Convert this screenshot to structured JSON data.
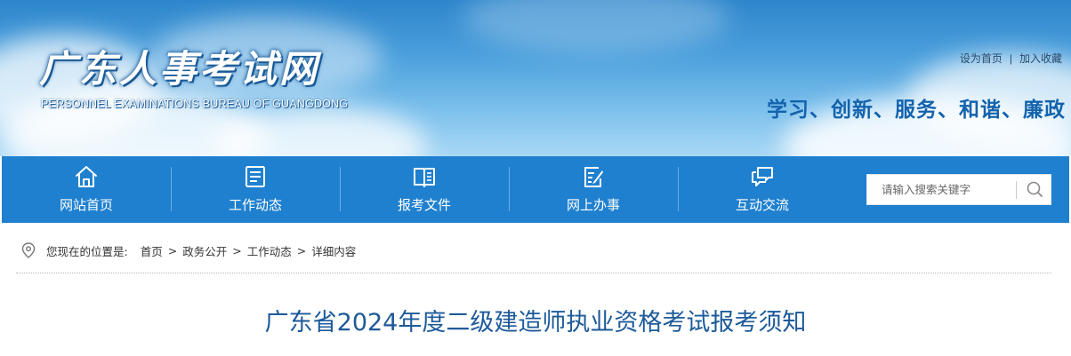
{
  "header": {
    "site_title": "广东人事考试网",
    "site_subtitle": "PERSONNEL EXAMINATIONS BUREAU OF GUANGDONG",
    "top_links": [
      "设为首页",
      "加入收藏"
    ],
    "slogan": "学习、创新、服务、和谐、廉政"
  },
  "nav": {
    "items": [
      {
        "label": "网站首页",
        "icon": "home-icon"
      },
      {
        "label": "工作动态",
        "icon": "news-icon"
      },
      {
        "label": "报考文件",
        "icon": "book-icon"
      },
      {
        "label": "网上办事",
        "icon": "edit-icon"
      },
      {
        "label": "互动交流",
        "icon": "chat-icon"
      }
    ],
    "search": {
      "placeholder": "请输入搜索关键字",
      "icon": "search-icon"
    }
  },
  "breadcrumb": {
    "icon": "location-pin-icon",
    "prefix": "您现在的位置是:",
    "items": [
      "首页",
      "政务公开",
      "工作动态",
      "详细内容"
    ],
    "separator": ">"
  },
  "article": {
    "title": "广东省2024年度二级建造师执业资格考试报考须知"
  },
  "colors": {
    "nav_bg": "#1f80cf",
    "slogan": "#1363ad",
    "title": "#1d5a9a"
  }
}
